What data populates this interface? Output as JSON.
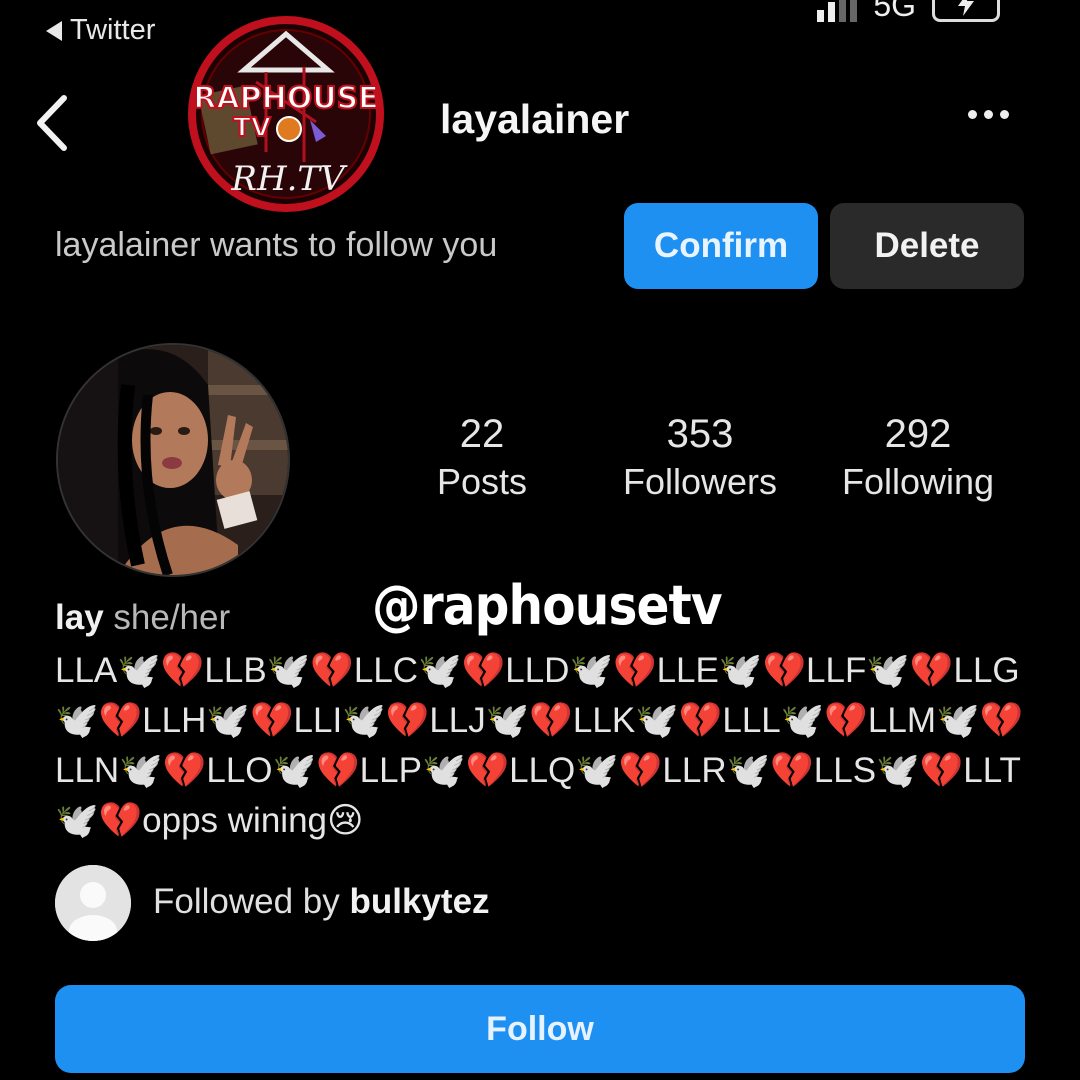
{
  "status_bar": {
    "back_app_label": "Twitter",
    "network": "5G",
    "battery_icon": "charging-battery-icon"
  },
  "header": {
    "username": "layalainer",
    "back_icon": "chevron-left-icon",
    "more_icon": "more-dots-icon"
  },
  "watermark": {
    "logo_text_line1": "RAPHOUSE",
    "logo_text_line2": "TV",
    "logo_text_line3": "RH.TV",
    "handle": "@raphousetv"
  },
  "follow_request": {
    "text": "layalainer wants to follow you",
    "confirm_label": "Confirm",
    "delete_label": "Delete"
  },
  "stats": {
    "posts_count": "22",
    "posts_label": "Posts",
    "followers_count": "353",
    "followers_label": "Followers",
    "following_count": "292",
    "following_label": "Following"
  },
  "bio": {
    "name": "lay",
    "pronouns": "she/her",
    "text": "LLA🕊️💔LLB🕊️💔LLC🕊️💔LLD🕊️💔LLE🕊️💔LLF🕊️💔LLG🕊️💔LLH🕊️💔LLI🕊️💔LLJ🕊️💔LLK🕊️💔LLL🕊️💔LLM🕊️💔LLN🕊️💔LLO🕊️💔LLP🕊️💔LLQ🕊️💔LLR🕊️💔LLS🕊️💔LLT🕊️💔opps wining😢"
  },
  "followed_by": {
    "prefix": "Followed by",
    "username": "bulkytez"
  },
  "follow_button_label": "Follow",
  "colors": {
    "background": "#000000",
    "accent_blue": "#1e90f2",
    "secondary_button": "#2a2a2a",
    "logo_red": "#b01020"
  }
}
